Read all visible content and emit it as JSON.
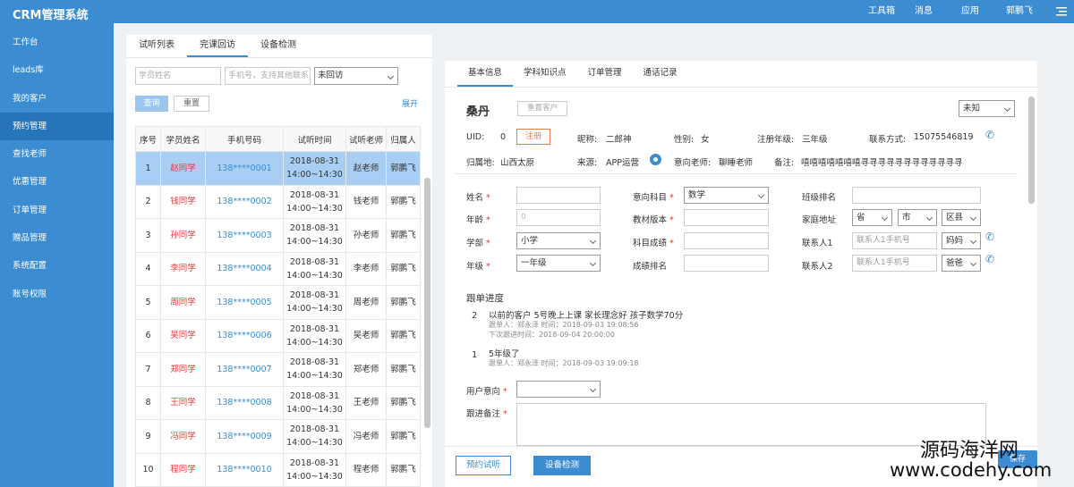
{
  "app": {
    "title": "CRM管理系统"
  },
  "topnav": [
    "工具箱",
    "消息",
    "应用",
    "郭鹏飞"
  ],
  "sidebar": {
    "items": [
      "工作台",
      "leads库",
      "我的客户",
      "预约管理",
      "查找老师",
      "优惠管理",
      "订单管理",
      "赠品管理",
      "系统配置",
      "账号权限"
    ],
    "active": 3
  },
  "left": {
    "tabs": [
      "试听列表",
      "完课回访",
      "设备检测"
    ],
    "active_tab": 1,
    "filters": {
      "name_placeholder": "学员姓名",
      "phone_placeholder": "手机号，支持其他联系人",
      "status": "未回访"
    },
    "buttons": {
      "search": "查询",
      "reset": "重置",
      "expand": "展开"
    },
    "columns": [
      "序号",
      "学员姓名",
      "手机号码",
      "试听时间",
      "试听老师",
      "归属人"
    ],
    "rows": [
      {
        "no": "1",
        "name": "赵同学",
        "phone": "138****0001",
        "date": "2018-08-31",
        "time": "14:00~14:30",
        "teacher": "赵老师",
        "owner": "郭鹏飞"
      },
      {
        "no": "2",
        "name": "钱同学",
        "phone": "138****0002",
        "date": "2018-08-31",
        "time": "14:00~14:30",
        "teacher": "钱老师",
        "owner": "郭鹏飞"
      },
      {
        "no": "3",
        "name": "孙同学",
        "phone": "138****0003",
        "date": "2018-08-31",
        "time": "14:00~14:30",
        "teacher": "孙老师",
        "owner": "郭鹏飞"
      },
      {
        "no": "4",
        "name": "李同学",
        "phone": "138****0004",
        "date": "2018-08-31",
        "time": "14:00~14:30",
        "teacher": "李老师",
        "owner": "郭鹏飞"
      },
      {
        "no": "5",
        "name": "周同学",
        "phone": "138****0005",
        "date": "2018-08-31",
        "time": "14:00~14:30",
        "teacher": "周老师",
        "owner": "郭鹏飞"
      },
      {
        "no": "6",
        "name": "吴同学",
        "phone": "138****0006",
        "date": "2018-08-31",
        "time": "14:00~14:30",
        "teacher": "吴老师",
        "owner": "郭鹏飞"
      },
      {
        "no": "7",
        "name": "郑同学",
        "phone": "138****0007",
        "date": "2018-08-31",
        "time": "14:00~14:30",
        "teacher": "郑老师",
        "owner": "郭鹏飞"
      },
      {
        "no": "8",
        "name": "王同学",
        "phone": "138****0008",
        "date": "2018-08-31",
        "time": "14:00~14:30",
        "teacher": "王老师",
        "owner": "郭鹏飞"
      },
      {
        "no": "9",
        "name": "冯同学",
        "phone": "138****0009",
        "date": "2018-08-31",
        "time": "14:00~14:30",
        "teacher": "冯老师",
        "owner": "郭鹏飞"
      },
      {
        "no": "10",
        "name": "程同学",
        "phone": "138****0010",
        "date": "2018-08-31",
        "time": "14:00~14:30",
        "teacher": "程老师",
        "owner": "郭鹏飞"
      }
    ]
  },
  "right": {
    "tabs": [
      "基本信息",
      "学科知识点",
      "订单管理",
      "通话记录"
    ],
    "active_tab": 0,
    "student_name": "桑丹",
    "reassign": "重置客户",
    "status_select": "未知",
    "uid_label": "UID:",
    "uid_value": "0",
    "register_btn": "注册",
    "nickname_label": "昵称:",
    "nickname": "二郎神",
    "gender_label": "性别:",
    "gender": "女",
    "grade_label": "注册年级:",
    "grade": "三年级",
    "contact_label": "联系方式:",
    "contact": "15075546819",
    "region_label": "归属地:",
    "region": "山西太原",
    "source_label": "来源:",
    "source": "APP运营",
    "intent_teacher_label": "意向老师:",
    "intent_teacher": "聊睡老师",
    "remark_label": "备注:",
    "remark": "嘻嘻嘻嘻嘻嘻嘻寻寻寻寻寻寻寻寻寻寻寻寻",
    "form": {
      "name": "姓名",
      "age": "年龄",
      "school": "学部",
      "grade": "年级",
      "subject": "意向科目",
      "textbook": "教材版本",
      "score": "科目成绩",
      "rank": "成绩排名",
      "class_rank": "班级排名",
      "address": "家庭地址",
      "contact1": "联系人1",
      "contact2": "联系人2",
      "age_value": "0",
      "subject_value": "数学",
      "school_value": "小学",
      "grade_value": "一年级",
      "province": "省",
      "city": "市",
      "district": "区县",
      "contact_placeholder": "联系人1手机号",
      "contact2_placeholder": "联系人1手机号",
      "relation1": "妈妈",
      "relation2": "爸爸"
    },
    "progress": {
      "title": "跟单进度",
      "items": [
        {
          "num": "2",
          "text": "以前的客户 5号晚上上课 家长理念好 孩子数学70分",
          "meta1": "跟单人：郑永泽 时间：2018-09-03 19:08:56",
          "meta2": "下次跟进时间：2018-09-04  20:00:00"
        },
        {
          "num": "1",
          "text": "5年级了",
          "meta1": "跟单人：郑永泽 时间：2018-09-03 19:09:18",
          "meta2": ""
        }
      ]
    },
    "user_intent": "用户意向",
    "followup_note": "跟进备注",
    "buttons": {
      "book": "预约试听",
      "device": "设备检测",
      "save": "保存"
    }
  },
  "watermark": {
    "line1": "源码海洋网",
    "line2": "www.codehy.com"
  }
}
